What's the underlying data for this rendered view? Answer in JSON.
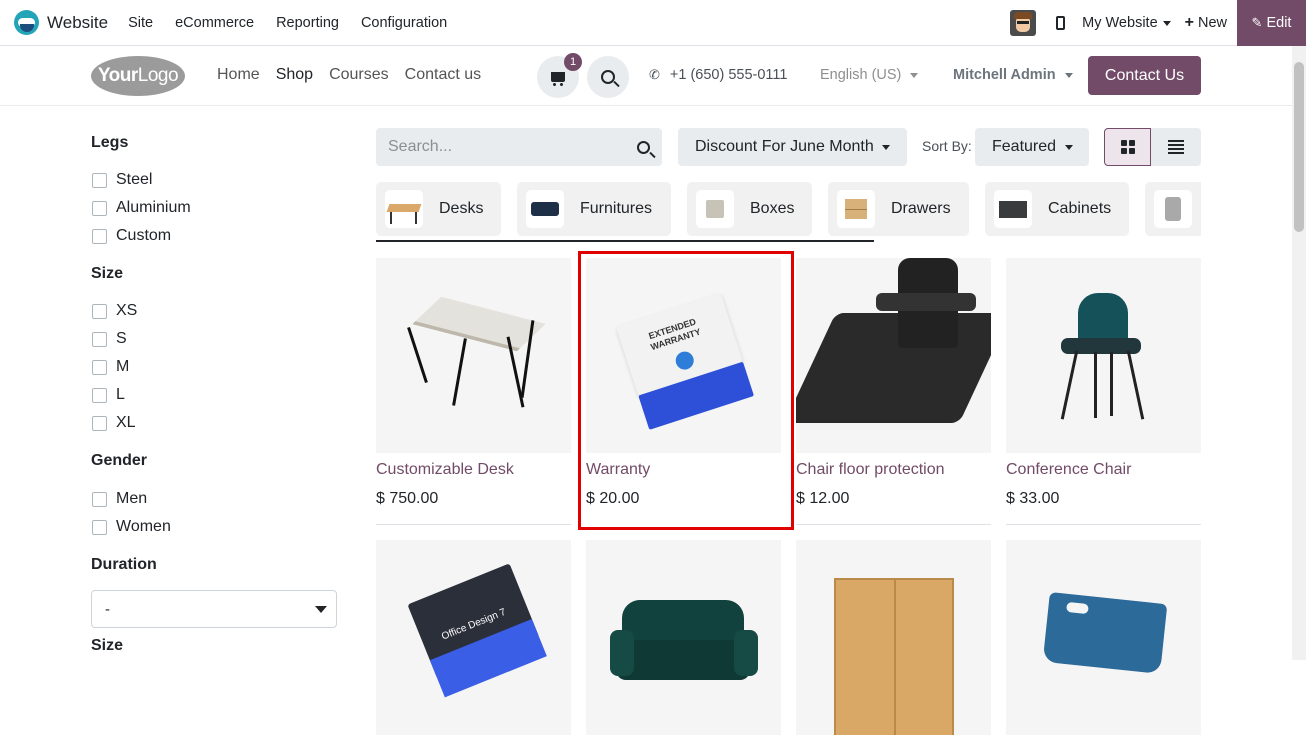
{
  "adminbar": {
    "app_title": "Website",
    "menu": [
      "Site",
      "eCommerce",
      "Reporting",
      "Configuration"
    ],
    "my_website": "My Website",
    "new_label": "New",
    "edit_label": "Edit"
  },
  "header": {
    "logo_your": "Your",
    "logo_logo": "Logo",
    "nav": [
      "Home",
      "Shop",
      "Courses",
      "Contact us"
    ],
    "cart_count": "1",
    "phone": "+1 (650) 555-0111",
    "language": "English (US)",
    "user": "Mitchell Admin",
    "contact_button": "Contact Us"
  },
  "sidebar": {
    "groups": [
      {
        "title": "Legs",
        "options": [
          "Steel",
          "Aluminium",
          "Custom"
        ]
      },
      {
        "title": "Size",
        "options": [
          "XS",
          "S",
          "M",
          "L",
          "XL"
        ]
      },
      {
        "title": "Gender",
        "options": [
          "Men",
          "Women"
        ]
      },
      {
        "title": "Duration",
        "select_value": "-"
      },
      {
        "title": "Size"
      }
    ]
  },
  "toolbar": {
    "search_placeholder": "Search...",
    "pricelist": "Discount For June Month",
    "sort_label": "Sort By:",
    "sort_value": "Featured"
  },
  "categories": [
    "Desks",
    "Furnitures",
    "Boxes",
    "Drawers",
    "Cabinets"
  ],
  "products": [
    {
      "name": "Customizable Desk",
      "price": "$ 750.00"
    },
    {
      "name": "Warranty",
      "price": "$ 20.00",
      "box_text": "EXTENDED WARRANTY"
    },
    {
      "name": "Chair floor protection",
      "price": "$ 12.00"
    },
    {
      "name": "Conference Chair",
      "price": "$ 33.00"
    },
    {
      "name": "",
      "price": "",
      "box_text": "Office Design 7"
    },
    {
      "name": "",
      "price": ""
    },
    {
      "name": "",
      "price": ""
    },
    {
      "name": "",
      "price": ""
    }
  ],
  "colors": {
    "brand": "#714b67",
    "highlight": "#e00000",
    "product_link": "#714b67"
  }
}
